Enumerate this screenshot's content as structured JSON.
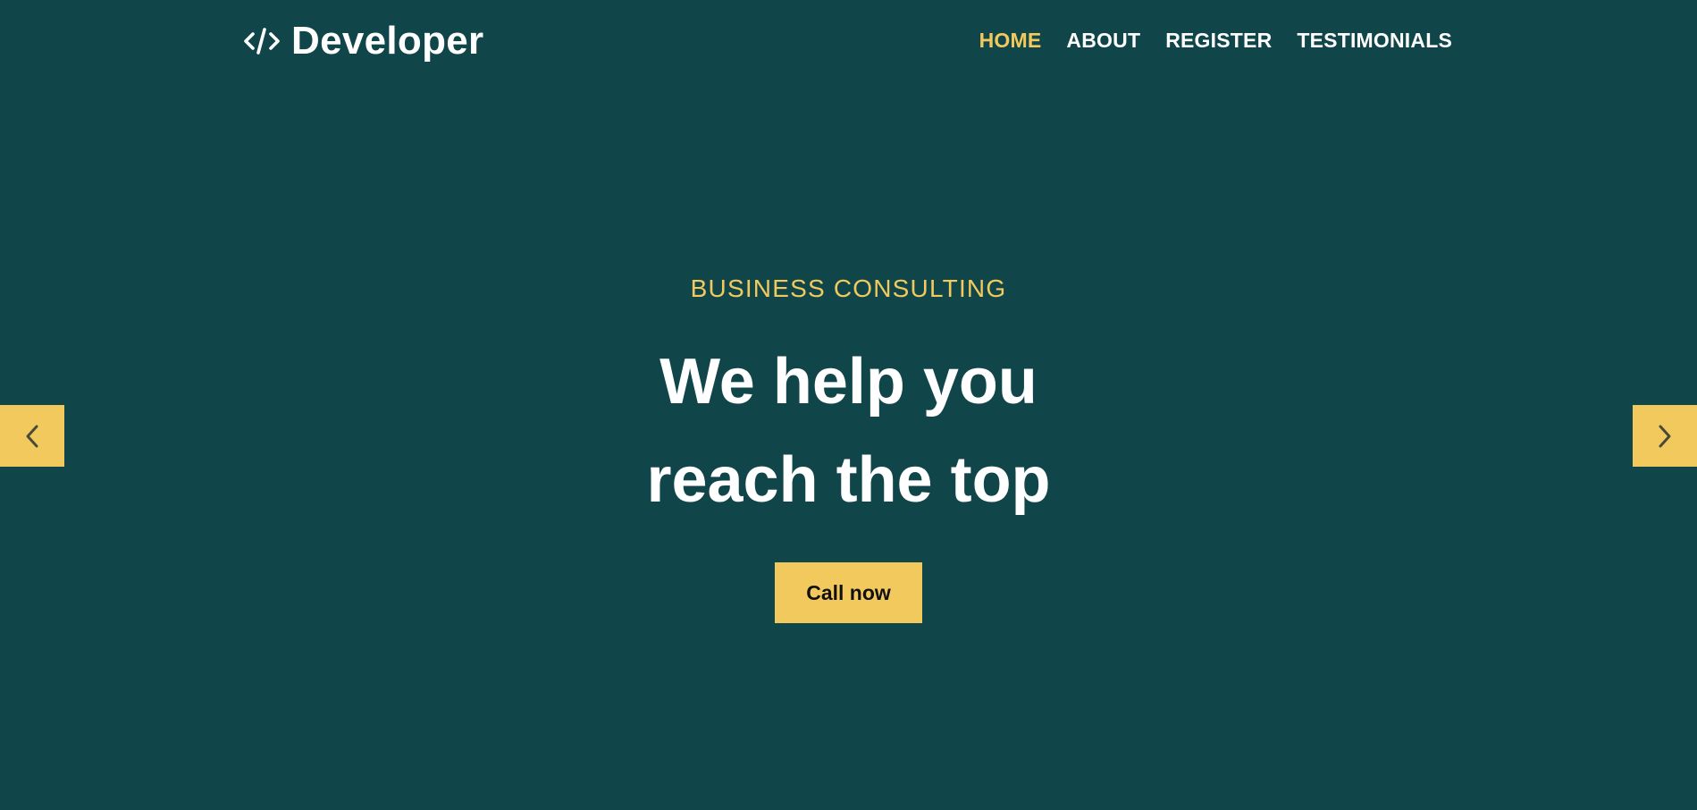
{
  "brand": {
    "icon": "code-icon",
    "name": "Developer"
  },
  "nav": {
    "items": [
      {
        "label": "HOME",
        "active": true
      },
      {
        "label": "ABOUT",
        "active": false
      },
      {
        "label": "REGISTER",
        "active": false
      },
      {
        "label": "TESTIMONIALS",
        "active": false
      }
    ]
  },
  "hero": {
    "eyebrow": "BUSINESS CONSULTING",
    "headline_line1": "We help you",
    "headline_line2": "reach the top",
    "cta_label": "Call now"
  },
  "slider": {
    "prev_icon": "chevron-left-icon",
    "next_icon": "chevron-right-icon"
  },
  "colors": {
    "background": "#10464a",
    "accent": "#f1c95c",
    "text": "#ffffff",
    "button_text": "#111111"
  }
}
